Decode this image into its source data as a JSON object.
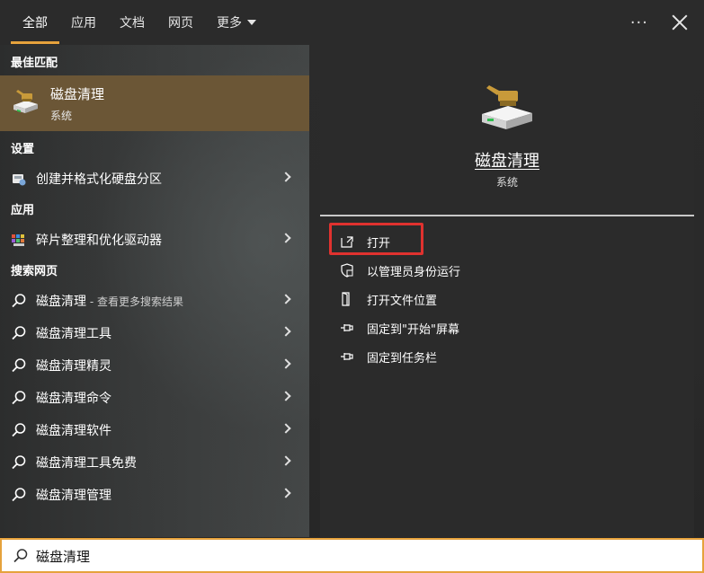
{
  "tabs": [
    {
      "label": "全部",
      "active": true
    },
    {
      "label": "应用"
    },
    {
      "label": "文档"
    },
    {
      "label": "网页"
    },
    {
      "label": "更多"
    }
  ],
  "topbar": {
    "more_options": "···"
  },
  "sections": {
    "best_match": "最佳匹配",
    "settings": "设置",
    "apps": "应用",
    "web": "搜索网页"
  },
  "best_match": {
    "title": "磁盘清理",
    "subtitle": "系统",
    "icon": "disk-cleanup-icon"
  },
  "settings_items": [
    {
      "label": "创建并格式化硬盘分区",
      "icon": "disk-management-icon"
    }
  ],
  "app_items": [
    {
      "label": "碎片整理和优化驱动器",
      "icon": "defrag-icon"
    }
  ],
  "web_items": [
    {
      "label": "磁盘清理",
      "suffix": " - 查看更多搜索结果"
    },
    {
      "label": "磁盘清理工具"
    },
    {
      "label": "磁盘清理精灵"
    },
    {
      "label": "磁盘清理命令"
    },
    {
      "label": "磁盘清理软件"
    },
    {
      "label": "磁盘清理工具免费"
    },
    {
      "label": "磁盘清理管理"
    }
  ],
  "detail": {
    "title": "磁盘清理",
    "subtitle": "系统",
    "actions": [
      {
        "label": "打开",
        "icon": "open-icon"
      },
      {
        "label": "以管理员身份运行",
        "icon": "shield-icon"
      },
      {
        "label": "打开文件位置",
        "icon": "file-location-icon"
      },
      {
        "label": "固定到\"开始\"屏幕",
        "icon": "pin-icon"
      },
      {
        "label": "固定到任务栏",
        "icon": "pin-icon"
      }
    ]
  },
  "search": {
    "value": "磁盘清理",
    "icon": "search-icon"
  },
  "colors": {
    "accent": "#e6a23c",
    "best_match_bg": "#6b5636",
    "highlight": "#e0322f"
  }
}
